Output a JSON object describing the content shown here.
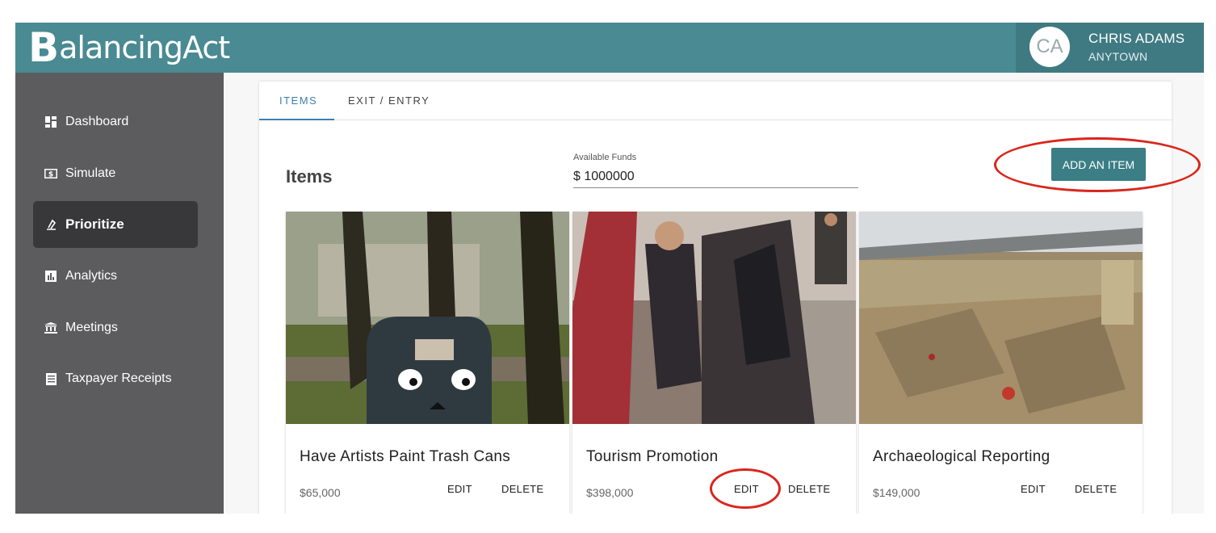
{
  "header": {
    "logo_big": "B",
    "logo_rest": "alancingAct",
    "user_initials": "CA",
    "user_name": "CHRIS ADAMS",
    "user_town": "ANYTOWN"
  },
  "sidebar": {
    "items": [
      {
        "label": "Dashboard",
        "icon": "dashboard-icon"
      },
      {
        "label": "Simulate",
        "icon": "dollar-icon"
      },
      {
        "label": "Prioritize",
        "icon": "scale-icon",
        "active": true
      },
      {
        "label": "Analytics",
        "icon": "bar-chart-icon"
      },
      {
        "label": "Meetings",
        "icon": "institution-icon"
      },
      {
        "label": "Taxpayer Receipts",
        "icon": "receipt-icon"
      }
    ]
  },
  "tabs": [
    {
      "label": "ITEMS",
      "active": true
    },
    {
      "label": "EXIT / ENTRY",
      "active": false
    }
  ],
  "main": {
    "title": "Items",
    "funds_label": "Available Funds",
    "funds_value": "$ 1000000",
    "add_label": "ADD AN ITEM"
  },
  "cards": [
    {
      "title": "Have Artists Paint Trash Cans",
      "price": "$65,000",
      "edit": "EDIT",
      "delete": "DELETE"
    },
    {
      "title": "Tourism Promotion",
      "price": "$398,000",
      "edit": "EDIT",
      "delete": "DELETE"
    },
    {
      "title": "Archaeological Reporting",
      "price": "$149,000",
      "edit": "EDIT",
      "delete": "DELETE"
    }
  ],
  "colors": {
    "header": "#4a8a92",
    "sidebar": "#5c5c5f",
    "accent_button": "#3b7e85",
    "tab_active": "#3e7fa8",
    "annotation": "#d9261c"
  }
}
